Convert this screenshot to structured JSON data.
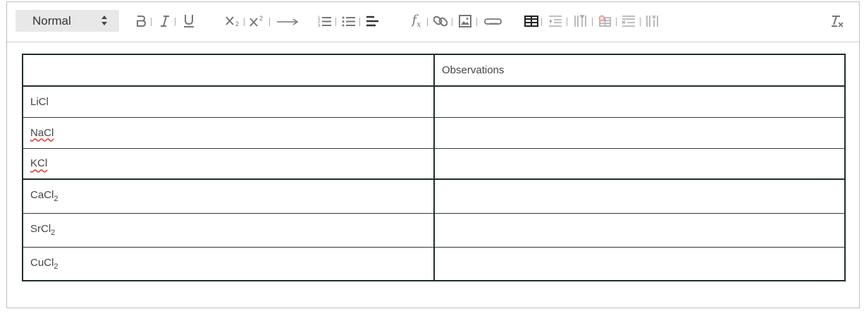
{
  "toolbar": {
    "format_value": "Normal",
    "buttons": [
      {
        "name": "bold",
        "icon": "bold-icon"
      },
      {
        "name": "italic",
        "icon": "italic-icon"
      },
      {
        "name": "underline",
        "icon": "underline-icon"
      },
      {
        "name": "subscript",
        "icon": "subscript-icon"
      },
      {
        "name": "superscript",
        "icon": "superscript-icon"
      },
      {
        "name": "arrow",
        "icon": "arrow-right-icon"
      },
      {
        "name": "ordered-list",
        "icon": "ordered-list-icon"
      },
      {
        "name": "bullet-list",
        "icon": "bullet-list-icon"
      },
      {
        "name": "align",
        "icon": "align-left-icon"
      },
      {
        "name": "formula",
        "icon": "formula-icon"
      },
      {
        "name": "link",
        "icon": "link-icon"
      },
      {
        "name": "image",
        "icon": "image-icon"
      },
      {
        "name": "attachment",
        "icon": "paperclip-icon"
      },
      {
        "name": "table",
        "icon": "table-icon"
      },
      {
        "name": "insert-row",
        "icon": "insert-row-icon"
      },
      {
        "name": "insert-column",
        "icon": "insert-column-icon"
      },
      {
        "name": "delete-table",
        "icon": "delete-table-icon"
      },
      {
        "name": "delete-row",
        "icon": "delete-row-icon"
      },
      {
        "name": "delete-column",
        "icon": "delete-column-icon"
      },
      {
        "name": "clear-format",
        "icon": "clear-format-icon"
      }
    ]
  },
  "table": {
    "header": [
      "",
      "Observations"
    ],
    "rows": [
      {
        "name": "LiCl",
        "observation": ""
      },
      {
        "name": "NaCl",
        "observation": ""
      },
      {
        "name": "KCl",
        "observation": ""
      },
      {
        "base": "CaCl",
        "sub": "2",
        "observation": ""
      },
      {
        "base": "SrCl",
        "sub": "2",
        "observation": ""
      },
      {
        "base": "CuCl",
        "sub": "2",
        "observation": ""
      }
    ]
  },
  "colors": {
    "border": "#1f2d2d",
    "icon": "#777777",
    "select_bg": "#e8e8e8",
    "spellcheck": "#dd3333"
  }
}
